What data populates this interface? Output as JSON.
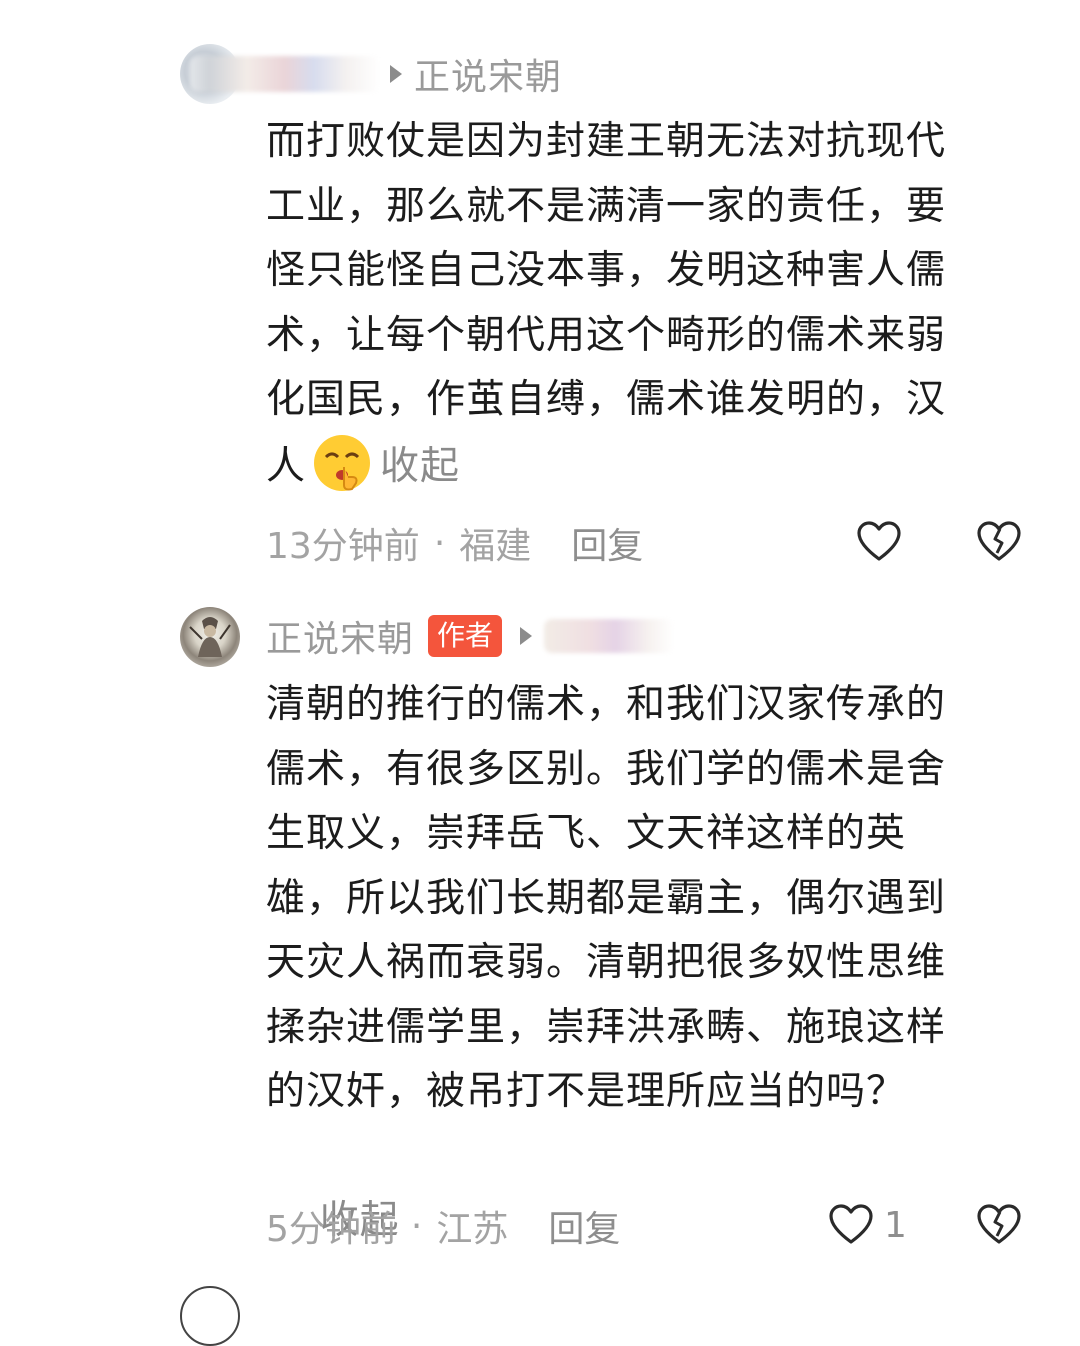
{
  "comments": [
    {
      "username": "正说宋朝",
      "text": "而打败仗是因为封建王朝无法对抗现代工业，那么就不是满清一家的责任，要怪只能怪自己没本事，发明这种害人儒术，让每个朝代用这个畸形的儒术来弱化国民，作茧自缚，儒术谁发明的，汉人",
      "emoji": "shushing-face-emoji",
      "collapse_label": "收起",
      "time": "13分钟前",
      "location": "福建",
      "reply_label": "回复",
      "like_count": ""
    },
    {
      "username": "正说宋朝",
      "author_badge": "作者",
      "text": "清朝的推行的儒术，和我们汉家传承的儒术，有很多区别。我们学的儒术是舍生取义，崇拜岳飞、文天祥这样的英雄，所以我们长期都是霸主，偶尔遇到天灾人祸而衰弱。清朝把很多奴性思维揉杂进儒学里，崇拜洪承畴、施琅这样的汉奸，被吊打不是理所应当的吗？",
      "collapse_label": "收起",
      "time": "5分钟前",
      "location": "江苏",
      "reply_label": "回复",
      "like_count": "1"
    }
  ],
  "separator": "·",
  "colors": {
    "author_badge": "#f4553c",
    "secondary_text": "#9a9a9a",
    "body_text": "#1c1c1c"
  }
}
